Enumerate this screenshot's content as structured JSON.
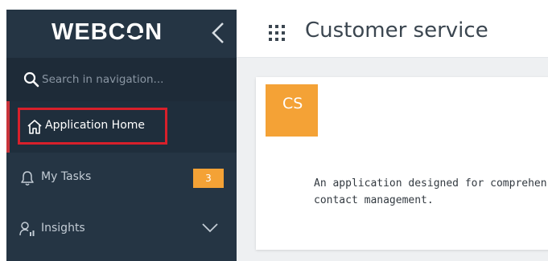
{
  "brand": {
    "logo_text_before": "WEBC",
    "logo_text_o": "O",
    "logo_text_after": "N"
  },
  "sidebar": {
    "search": {
      "placeholder": "Search in navigation...",
      "value": ""
    },
    "items": [
      {
        "label": "Application Home",
        "icon": "home-icon",
        "selected": true
      },
      {
        "label": "My Tasks",
        "icon": "bell-icon",
        "badge": "3"
      },
      {
        "label": "Insights",
        "icon": "user-chart-icon",
        "expandable": true
      }
    ]
  },
  "header": {
    "app_title": "Customer service"
  },
  "app_card": {
    "tile_text": "CS",
    "description_line1": "An application designed for comprehen",
    "description_line2": "contact management."
  },
  "colors": {
    "sidebar_bg": "#253544",
    "search_bg": "#1e2b38",
    "accent_orange": "#f4a236",
    "highlight_red": "#d8202b"
  }
}
